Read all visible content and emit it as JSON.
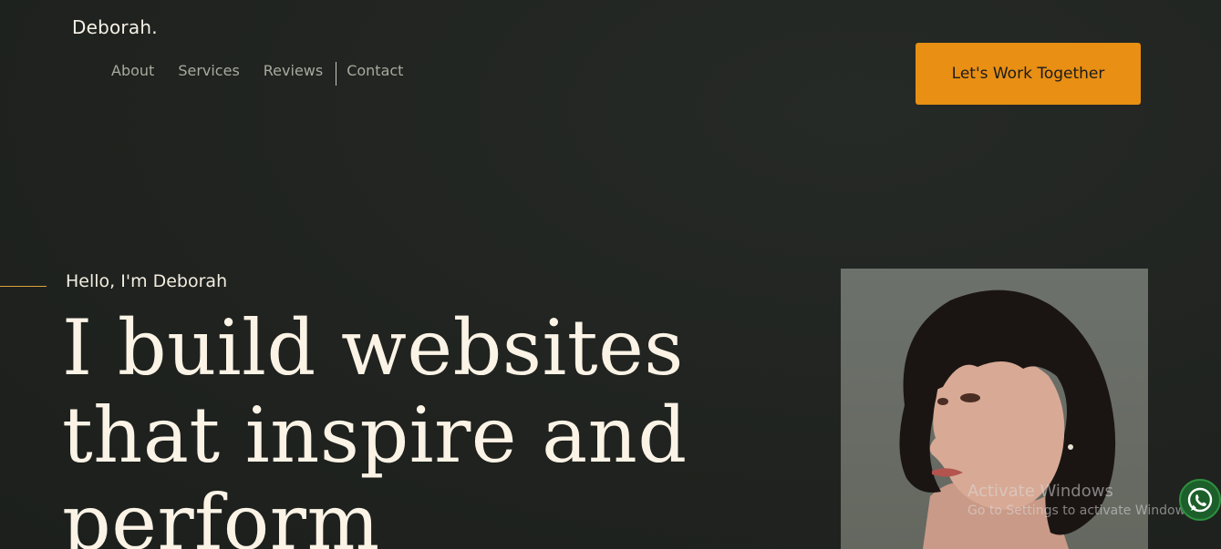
{
  "brand": {
    "logo_text": "Deborah."
  },
  "nav": {
    "items": [
      "About",
      "Services",
      "Reviews",
      "Contact"
    ]
  },
  "cta": {
    "label": "Let's Work Together",
    "color": "#e88f14"
  },
  "hero": {
    "greeting": "Hello, I'm Deborah",
    "headline_lines": [
      "I build websites",
      "that inspire and",
      "perform"
    ]
  },
  "watermark": {
    "title": "Activate Windows",
    "subtitle": "Go to Settings to activate Windows."
  },
  "icons": {
    "chat_button": "whatsapp-icon"
  },
  "colors": {
    "background": "#20231f",
    "text": "#fbf3e6",
    "accent": "#e88f14"
  }
}
